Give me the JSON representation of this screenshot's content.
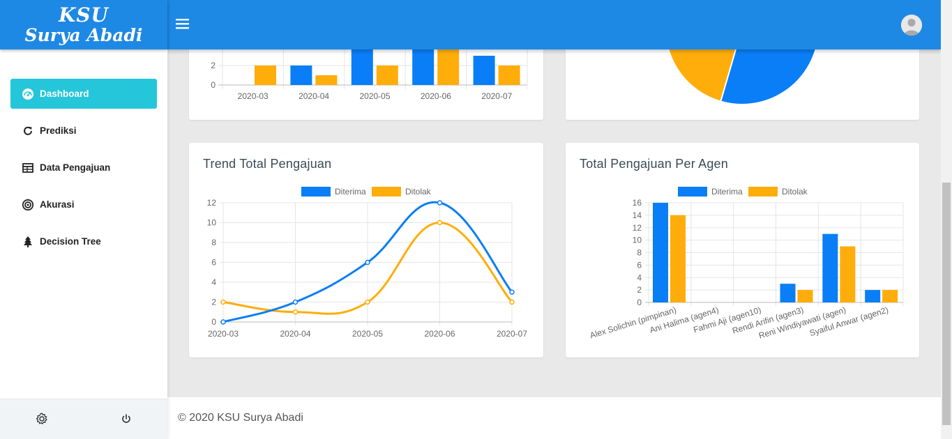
{
  "brand": {
    "line1": "KSU",
    "line2": "Surya Abadi"
  },
  "sidebar": {
    "items": [
      {
        "label": "Dashboard",
        "icon": "dashboard-icon",
        "active": true
      },
      {
        "label": "Prediksi",
        "icon": "refresh-icon"
      },
      {
        "label": "Data Pengajuan",
        "icon": "table-icon"
      },
      {
        "label": "Akurasi",
        "icon": "target-icon"
      },
      {
        "label": "Decision Tree",
        "icon": "tree-icon"
      }
    ]
  },
  "colors": {
    "primary": "#1e88e5",
    "active": "#26c6da",
    "diterima": "#0a7ef7",
    "ditolak": "#ffad0a"
  },
  "footer": {
    "text": "© 2020 KSU Surya Abadi"
  },
  "chart_data": [
    {
      "type": "bar",
      "categories": [
        "2020-03",
        "2020-04",
        "2020-05",
        "2020-06",
        "2020-07"
      ],
      "series": [
        {
          "name": "Diterima",
          "values": [
            0,
            2,
            6,
            12,
            3
          ]
        },
        {
          "name": "Ditolak",
          "values": [
            2,
            1,
            2,
            10,
            2
          ]
        }
      ],
      "yticks_visible": [
        "2",
        "0"
      ],
      "note_partial": true
    },
    {
      "type": "pie",
      "partial": true
    },
    {
      "type": "line",
      "title": "Trend Total Pengajuan",
      "categories": [
        "2020-03",
        "2020-04",
        "2020-05",
        "2020-06",
        "2020-07"
      ],
      "series": [
        {
          "name": "Diterima",
          "values": [
            0,
            2,
            6,
            12,
            3
          ]
        },
        {
          "name": "Ditolak",
          "values": [
            2,
            1,
            2,
            10,
            2
          ]
        }
      ],
      "ylim": [
        0,
        12
      ],
      "yticks": [
        "12",
        "10",
        "8",
        "6",
        "4",
        "2",
        "0"
      ],
      "legend": "top",
      "grid": true
    },
    {
      "type": "bar",
      "title": "Total Pengajuan Per Agen",
      "categories": [
        "Alex Solichin (pimpinan)",
        "Ani Halima (agen4)",
        "Fahmi Aji (agen10)",
        "Rendi Arifin (agen3)",
        "Reni Windiyawati (agen)",
        "Syaiful Anwar (agen2)"
      ],
      "series": [
        {
          "name": "Diterima",
          "values": [
            16,
            0,
            0,
            3,
            11,
            2
          ]
        },
        {
          "name": "Ditolak",
          "values": [
            14,
            0,
            0,
            2,
            9,
            2
          ]
        }
      ],
      "ylim": [
        0,
        16
      ],
      "yticks": [
        "16",
        "14",
        "12",
        "10",
        "8",
        "6",
        "4",
        "2",
        "0"
      ],
      "legend": "top",
      "grid": true
    }
  ]
}
